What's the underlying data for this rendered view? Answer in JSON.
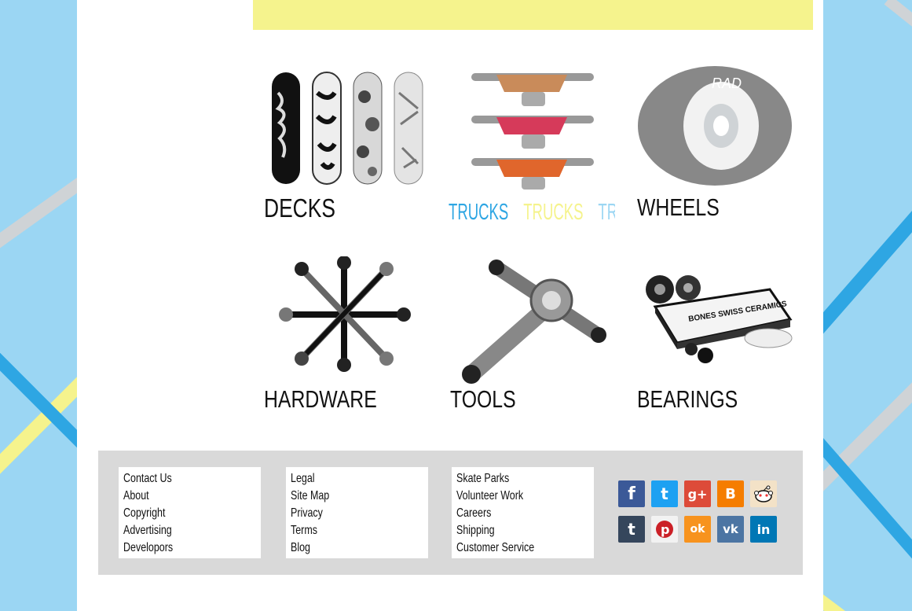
{
  "products": [
    {
      "key": "decks",
      "label": "DECKS"
    },
    {
      "key": "trucks",
      "label_parts": [
        "TRUCKS",
        "TRUCKS",
        "TRUCKS"
      ]
    },
    {
      "key": "wheels",
      "label": "WHEELS",
      "wheel_print": "RAD"
    },
    {
      "key": "hardware",
      "label": "HARDWARE"
    },
    {
      "key": "tools",
      "label": "TOOLS"
    },
    {
      "key": "bearings",
      "label": "BEARINGS",
      "box_text": "BONES SWISS CERAMICS"
    }
  ],
  "footer": {
    "col1": [
      "Contact Us",
      "About",
      "Copyright",
      "Advertising",
      "Developors"
    ],
    "col2": [
      "Legal",
      "Site Map",
      "Privacy",
      "Terms",
      "Blog"
    ],
    "col3": [
      "Skate Parks",
      "Volunteer Work",
      "Careers",
      "Shipping",
      "Customer Service"
    ]
  },
  "social": [
    {
      "name": "facebook-icon",
      "glyph": "f",
      "color": "#3b5998"
    },
    {
      "name": "twitter-icon",
      "glyph": "t",
      "color": "#1da1f2"
    },
    {
      "name": "google-plus-icon",
      "glyph": "g+",
      "color": "#dd4b39"
    },
    {
      "name": "blogger-icon",
      "glyph": "B",
      "color": "#f57d00"
    },
    {
      "name": "reddit-icon",
      "glyph": "r",
      "color": "#ff4500"
    },
    {
      "name": "tumblr-icon",
      "glyph": "t",
      "color": "#35465c"
    },
    {
      "name": "pinterest-icon",
      "glyph": "p",
      "color": "#cb2027"
    },
    {
      "name": "odnoklassniki-icon",
      "glyph": "ok",
      "color": "#f7931e"
    },
    {
      "name": "vk-icon",
      "glyph": "vk",
      "color": "#4c75a3"
    },
    {
      "name": "linkedin-icon",
      "glyph": "in",
      "color": "#0077b5"
    }
  ],
  "colors": {
    "background": "#9bd6f3",
    "banner": "#f5f38d",
    "footer": "#d9d9d9",
    "stripe_blue": "#2ea6e3",
    "stripe_yellow": "#f5f38d",
    "stripe_gray": "#cfd3d6"
  }
}
